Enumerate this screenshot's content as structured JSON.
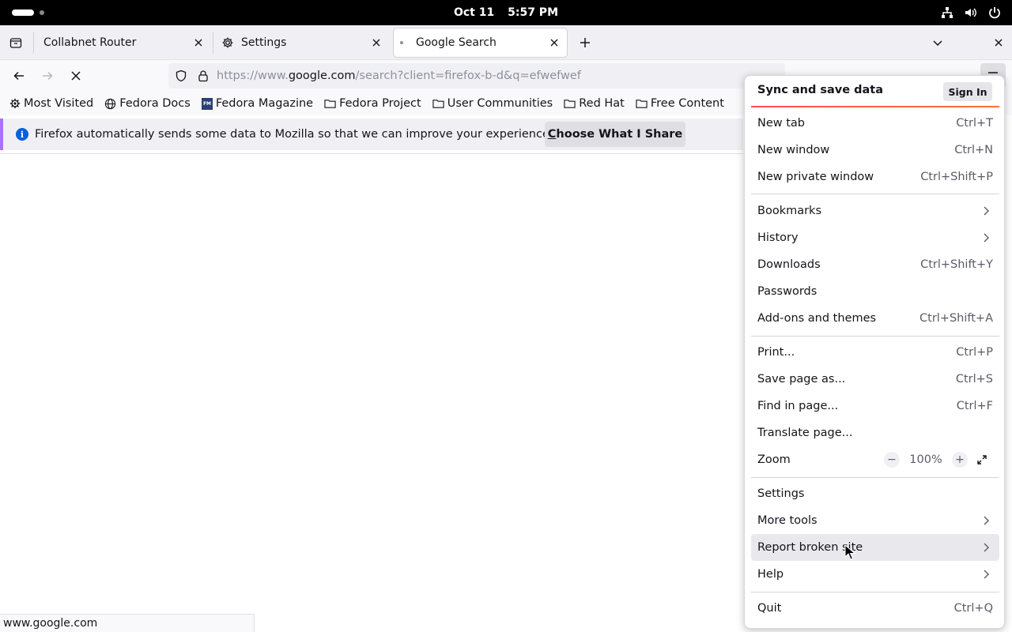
{
  "system_bar": {
    "date": "Oct 11",
    "time": "5:57 PM",
    "icons": [
      "network-icon",
      "volume-icon",
      "power-icon"
    ]
  },
  "tabs": [
    {
      "title": "Collabnet Router",
      "active": false
    },
    {
      "title": "Settings",
      "active": false,
      "icon": "gear-icon"
    },
    {
      "title": "Google Search",
      "active": true,
      "loading": true
    }
  ],
  "navbar": {
    "url_prefix": "https://www.",
    "url_domain": "google.com",
    "url_suffix": "/search?client=firefox-b-d&q=efwefwef"
  },
  "bookmarks": [
    {
      "label": "Most Visited",
      "icon": "gear-icon"
    },
    {
      "label": "Fedora Docs",
      "icon": "globe-icon"
    },
    {
      "label": "Fedora Magazine",
      "icon": "fm-icon"
    },
    {
      "label": "Fedora Project",
      "icon": "folder-icon"
    },
    {
      "label": "User Communities",
      "icon": "folder-icon"
    },
    {
      "label": "Red Hat",
      "icon": "folder-icon"
    },
    {
      "label": "Free Content",
      "icon": "folder-icon"
    }
  ],
  "notification": {
    "message": "Firefox automatically sends some data to Mozilla so that we can improve your experience.",
    "button_access_key": "C",
    "button_rest": "hoose What I Share"
  },
  "status_text": "www.google.com",
  "app_menu": {
    "header_title": "Sync and save data",
    "sign_in": "Sign In",
    "groups": [
      [
        {
          "label": "New tab",
          "shortcut": "Ctrl+T"
        },
        {
          "label": "New window",
          "shortcut": "Ctrl+N"
        },
        {
          "label": "New private window",
          "shortcut": "Ctrl+Shift+P"
        }
      ],
      [
        {
          "label": "Bookmarks",
          "submenu": true
        },
        {
          "label": "History",
          "submenu": true
        },
        {
          "label": "Downloads",
          "shortcut": "Ctrl+Shift+Y"
        },
        {
          "label": "Passwords"
        },
        {
          "label": "Add-ons and themes",
          "shortcut": "Ctrl+Shift+A"
        }
      ],
      [
        {
          "label": "Print...",
          "shortcut": "Ctrl+P"
        },
        {
          "label": "Save page as...",
          "shortcut": "Ctrl+S"
        },
        {
          "label": "Find in page...",
          "shortcut": "Ctrl+F"
        },
        {
          "label": "Translate page..."
        },
        {
          "label": "Zoom",
          "zoom": true
        }
      ],
      [
        {
          "label": "Settings"
        },
        {
          "label": "More tools",
          "submenu": true
        },
        {
          "label": "Report broken site",
          "submenu": true,
          "hovered": true
        },
        {
          "label": "Help",
          "submenu": true
        }
      ],
      [
        {
          "label": "Quit",
          "shortcut": "Ctrl+Q"
        }
      ]
    ],
    "zoom": {
      "minus": "−",
      "value": "100%",
      "plus": "+"
    }
  }
}
